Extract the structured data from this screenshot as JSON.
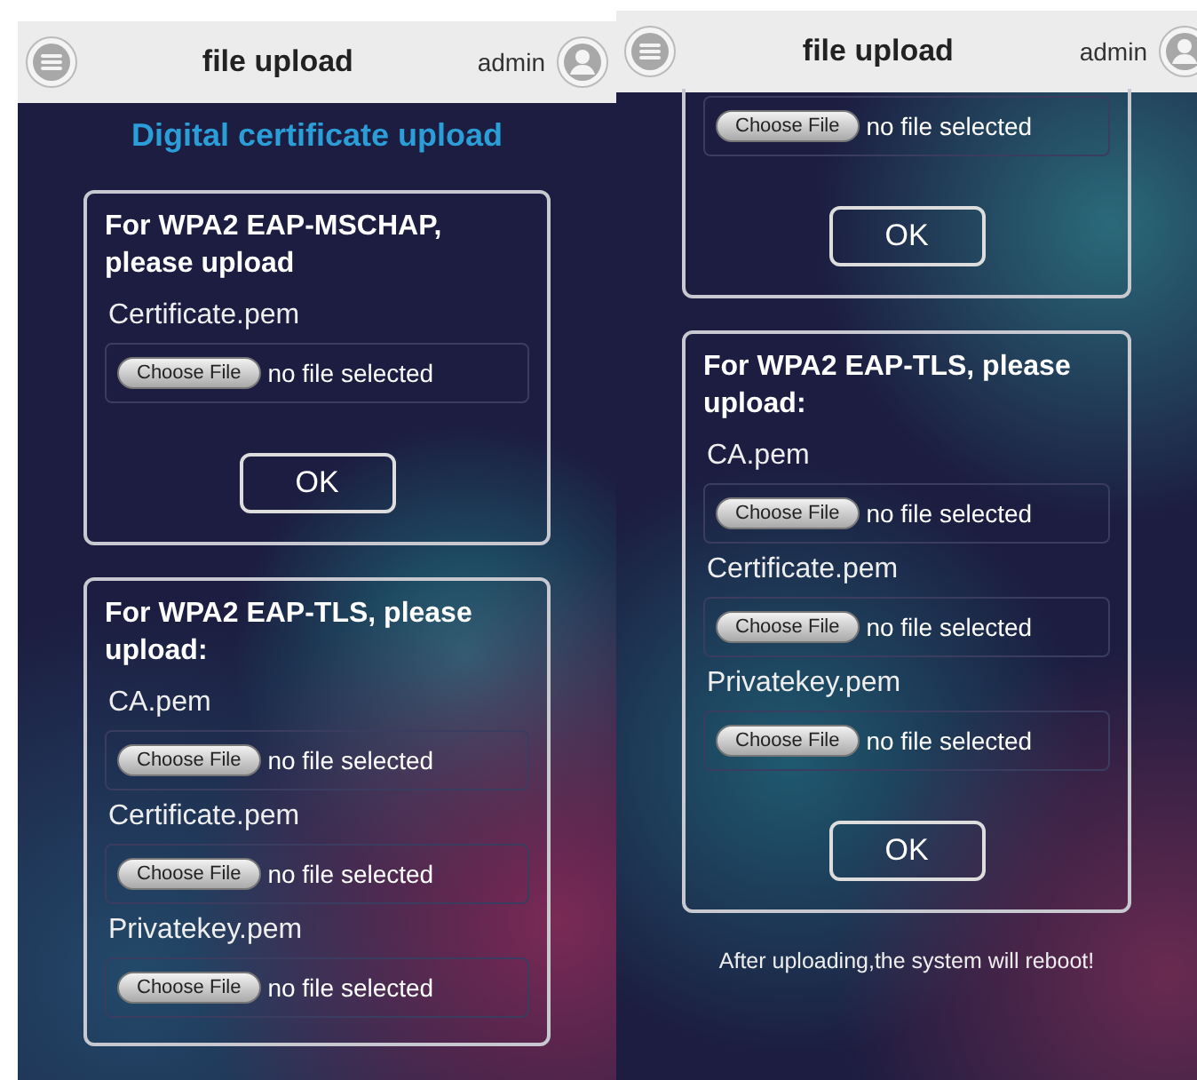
{
  "screens": [
    {
      "header": {
        "title": "file upload",
        "user": "admin"
      },
      "page_title": "Digital certificate upload",
      "sections": [
        {
          "cut_top": false,
          "heading": "For WPA2 EAP-MSCHAP, please upload",
          "files": [
            {
              "label": "Certificate.pem",
              "button": "Choose File",
              "status": "no file selected"
            }
          ],
          "ok": "OK"
        },
        {
          "cut_top": false,
          "heading": "For WPA2 EAP-TLS, please upload:",
          "files": [
            {
              "label": "CA.pem",
              "button": "Choose File",
              "status": "no file selected"
            },
            {
              "label": "Certificate.pem",
              "button": "Choose File",
              "status": "no file selected"
            },
            {
              "label": "Privatekey.pem",
              "button": "Choose File",
              "status": "no file selected"
            }
          ]
        }
      ]
    },
    {
      "header": {
        "title": "file upload",
        "user": "admin"
      },
      "sections": [
        {
          "cut_top": true,
          "files": [
            {
              "button": "Choose File",
              "status": "no file selected"
            }
          ],
          "ok": "OK"
        },
        {
          "cut_top": false,
          "heading": "For WPA2 EAP-TLS, please upload:",
          "files": [
            {
              "label": "CA.pem",
              "button": "Choose File",
              "status": "no file selected"
            },
            {
              "label": "Certificate.pem",
              "button": "Choose File",
              "status": "no file selected"
            },
            {
              "label": "Privatekey.pem",
              "button": "Choose File",
              "status": "no file selected"
            }
          ],
          "ok": "OK"
        }
      ],
      "note": "After uploading,the system will reboot!"
    }
  ]
}
